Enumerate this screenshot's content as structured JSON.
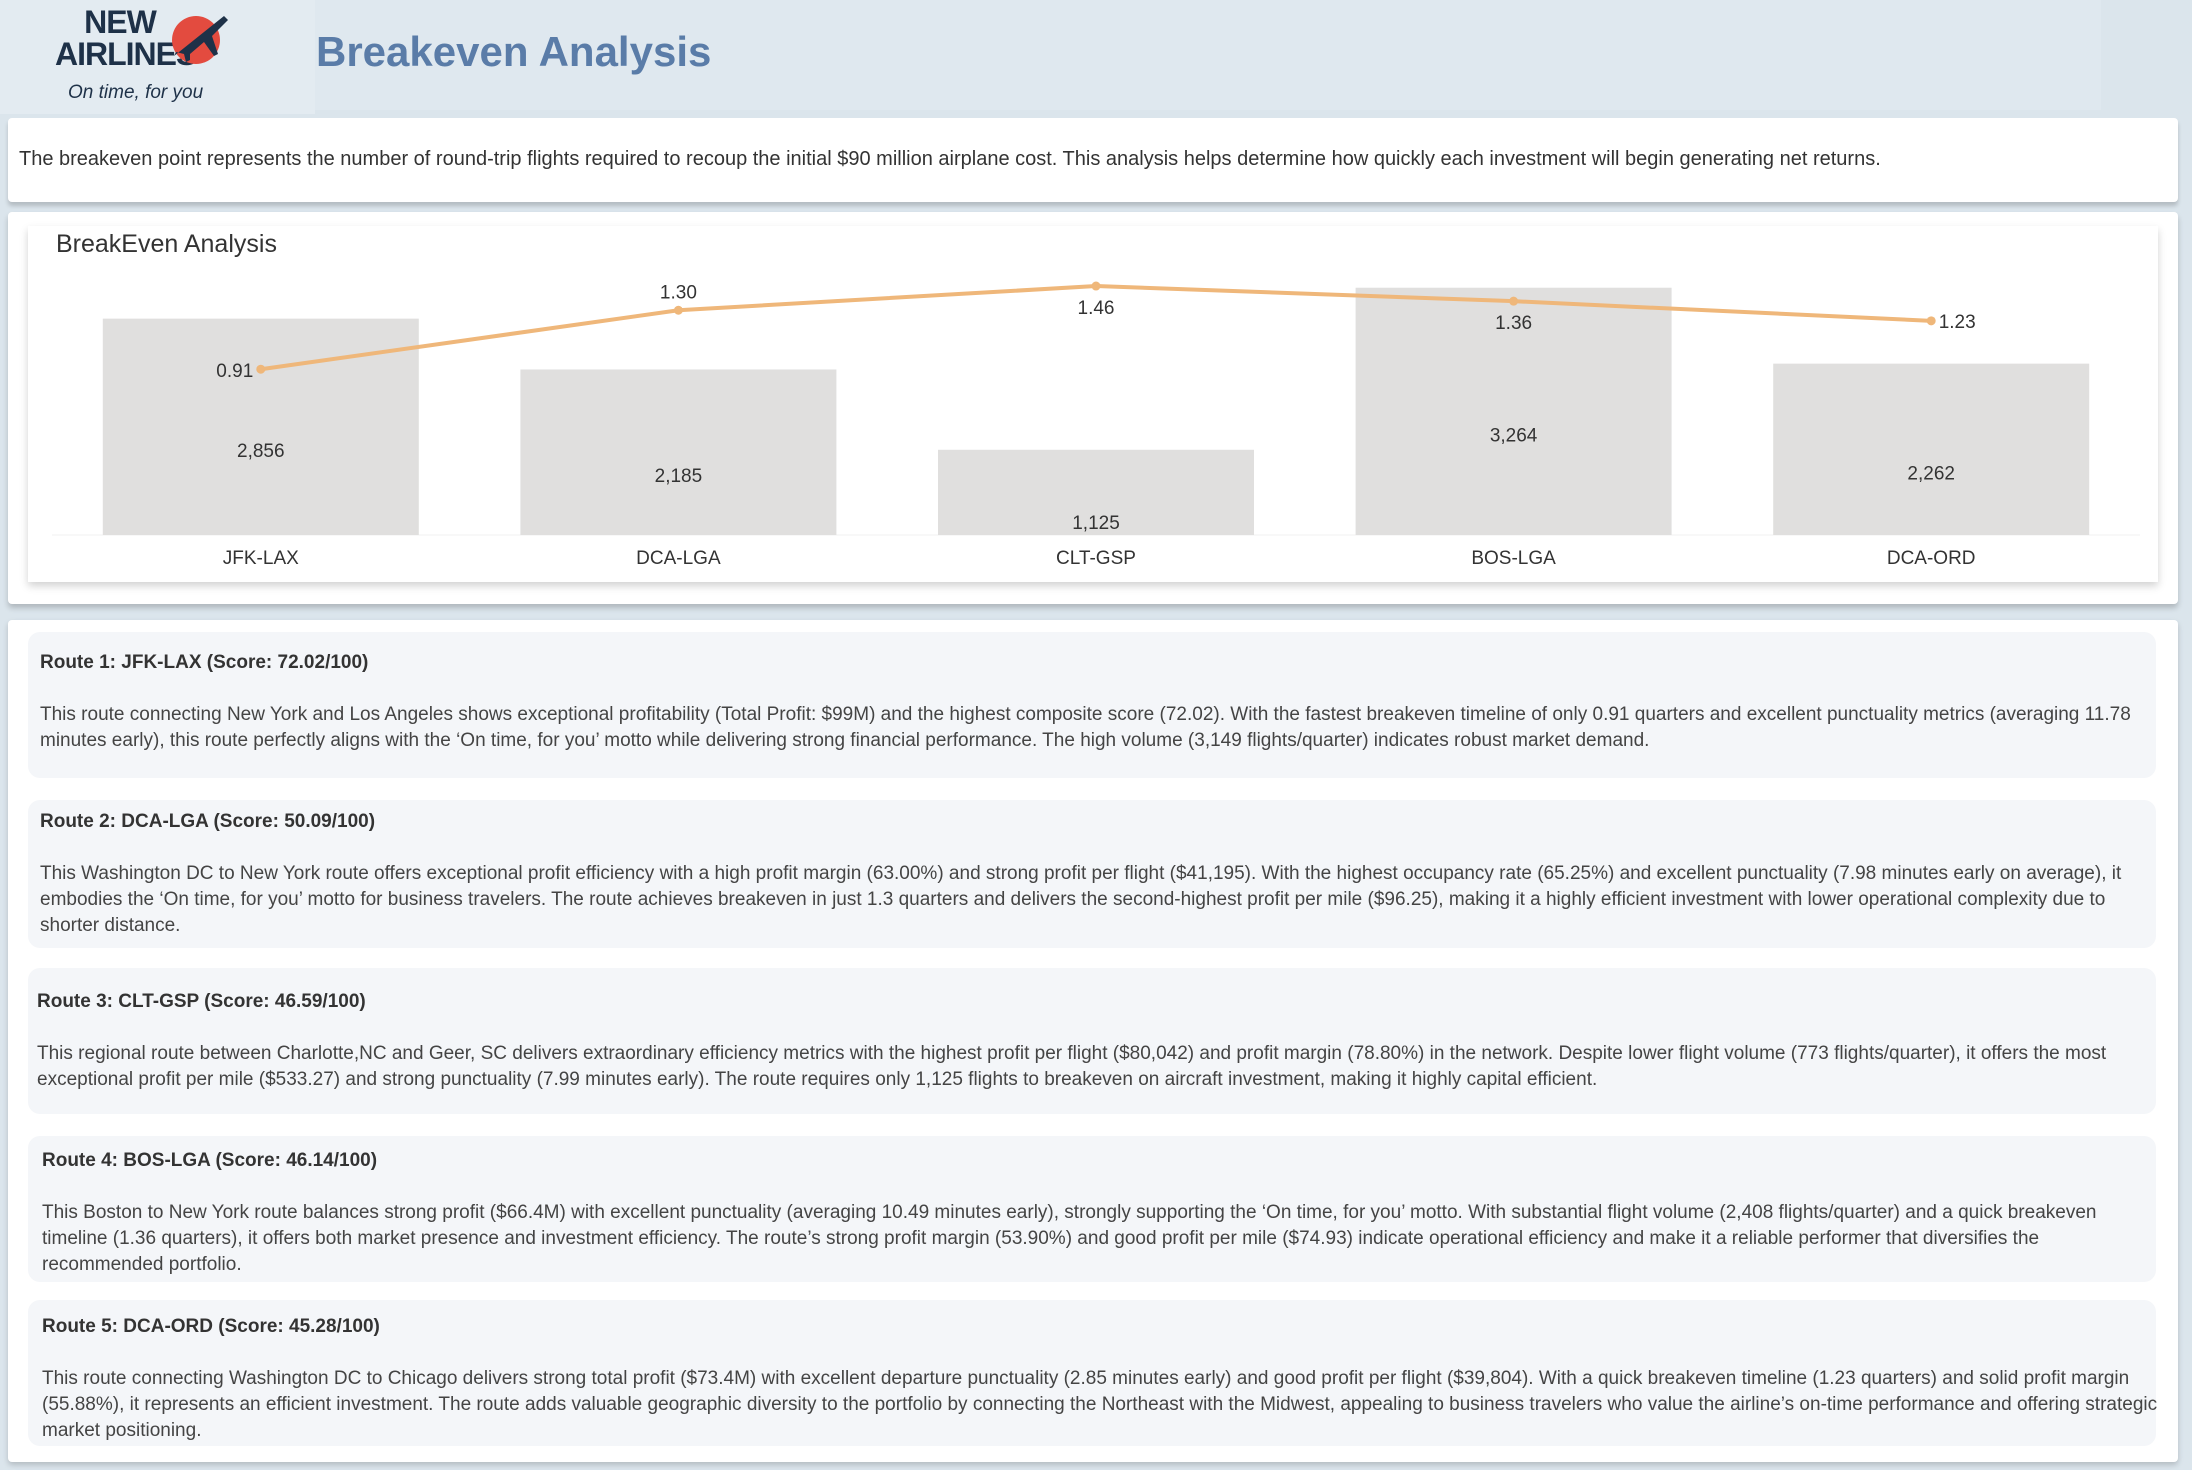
{
  "brand": {
    "name_line1": "NEW",
    "name_line2": "AIRLINES",
    "tagline": "On time, for you"
  },
  "page": {
    "title": "Breakeven Analysis",
    "intro": "The breakeven point represents the number of round-trip flights required to recoup the initial $90 million airplane cost. This analysis helps determine how quickly each investment will begin generating net returns."
  },
  "colors": {
    "bar": "#e0dfde",
    "line": "#efb77a",
    "title_blue": "#5a7ca8"
  },
  "chart_data": {
    "type": "bar",
    "title": "BreakEven Analysis",
    "categories": [
      "JFK-LAX",
      "DCA-LGA",
      "CLT-GSP",
      "BOS-LGA",
      "DCA-ORD"
    ],
    "series": [
      {
        "type": "bar",
        "values": [
          2856,
          2185,
          1125,
          3264,
          2262
        ],
        "labels": [
          "2,856",
          "2,185",
          "1,125",
          "3,264",
          "2,262"
        ]
      },
      {
        "type": "line",
        "values": [
          0.91,
          1.3,
          1.46,
          1.36,
          1.23
        ],
        "labels": [
          "0.91",
          "1.30",
          "1.46",
          "1.36",
          "1.23"
        ]
      }
    ],
    "grid": false,
    "legend": "none"
  },
  "routes": [
    {
      "title": "Route 1: JFK-LAX (Score: 72.02/100)",
      "body": "This route connecting New York and Los Angeles shows exceptional profitability (Total Profit: $99M) and the highest composite score (72.02). With the fastest breakeven timeline of only 0.91 quarters and excellent punctuality metrics (averaging 11.78 minutes early), this route perfectly aligns with the ‘On time, for you’ motto while delivering strong financial performance. The high volume (3,149 flights/quarter) indicates robust market demand."
    },
    {
      "title": "Route 2: DCA-LGA (Score: 50.09/100)",
      "body": "This Washington DC to New York route offers exceptional profit efficiency with a high profit margin (63.00%) and strong profit per flight ($41,195). With the highest occupancy rate (65.25%) and excellent punctuality (7.98 minutes early on average), it embodies the ‘On time, for you’ motto for business travelers. The route achieves breakeven in just 1.3 quarters and delivers the second-highest profit per mile ($96.25), making it a highly efficient investment with lower operational complexity due to shorter distance."
    },
    {
      "title": "Route 3: CLT-GSP (Score: 46.59/100)",
      "body": "This regional route between Charlotte,NC and Geer, SC delivers extraordinary efficiency metrics with the highest profit per flight ($80,042) and profit margin (78.80%) in the network. Despite lower flight volume (773 flights/quarter), it offers the most exceptional profit per mile ($533.27) and strong punctuality (7.99 minutes early). The route requires only 1,125 flights to breakeven on aircraft investment, making it highly capital efficient."
    },
    {
      "title": "Route 4: BOS-LGA (Score: 46.14/100)",
      "body": "This Boston to New York route balances strong profit ($66.4M) with excellent punctuality (averaging 10.49 minutes early), strongly supporting the ‘On time, for you’ motto. With substantial flight volume (2,408 flights/quarter) and a quick breakeven timeline (1.36 quarters), it offers both market presence and investment efficiency. The route’s strong profit margin (53.90%) and good profit per mile ($74.93) indicate operational efficiency and make it a reliable performer that diversifies the recommended portfolio."
    },
    {
      "title": "Route 5: DCA-ORD (Score: 45.28/100)",
      "body": "This route connecting Washington DC to Chicago delivers strong total profit ($73.4M) with excellent departure punctuality (2.85 minutes early) and good profit per flight ($39,804). With a quick breakeven timeline (1.23 quarters) and solid profit margin (55.88%), it represents an efficient investment. The route adds valuable geographic diversity to the portfolio by connecting the Northeast with the Midwest, appealing to business travelers who value the airline’s on-time performance and offering strategic market positioning."
    }
  ]
}
